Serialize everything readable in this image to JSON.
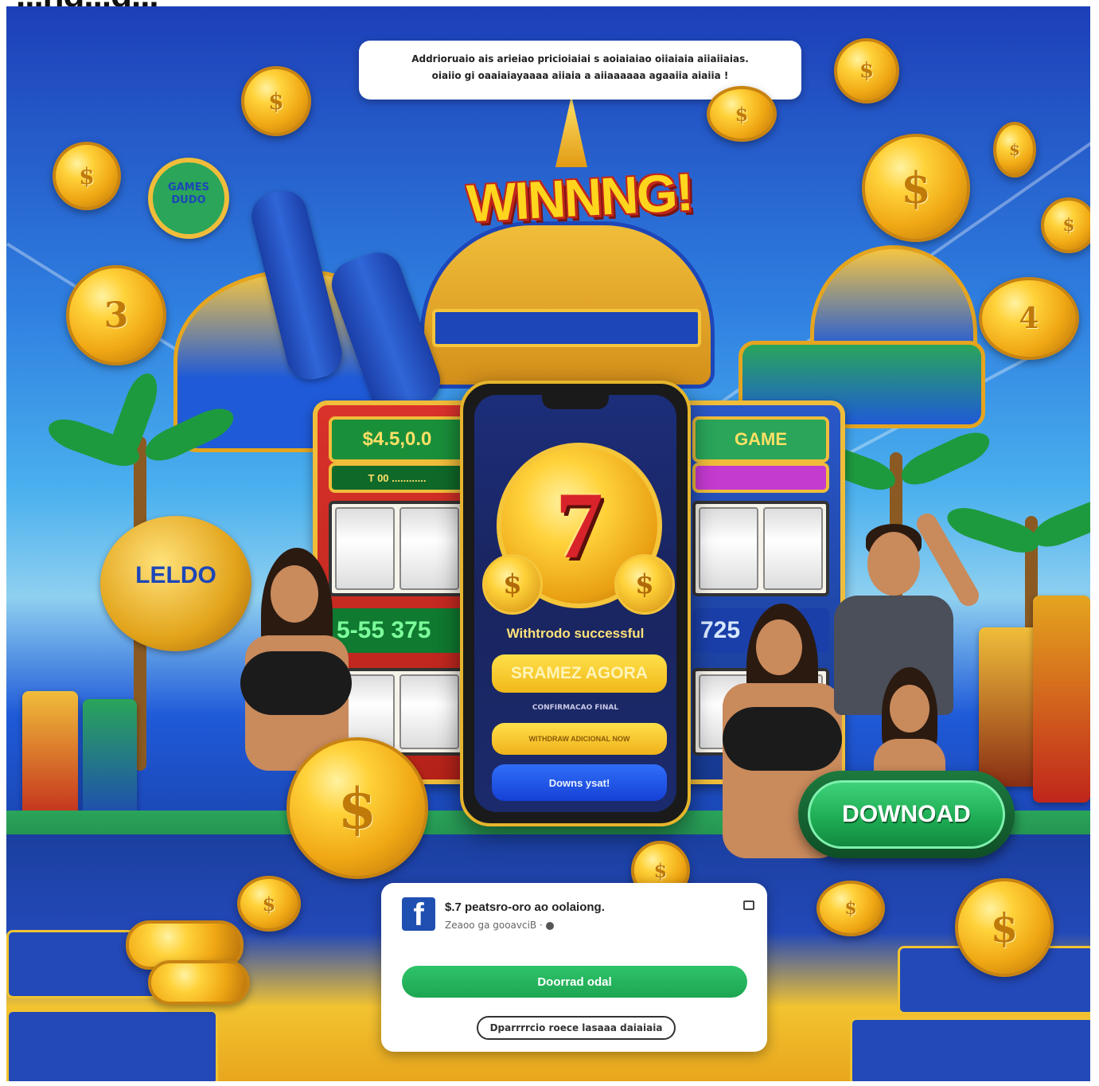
{
  "page": {
    "cropped_headline": "...ng...g..."
  },
  "tooltip": {
    "line1": "Addrioruaio ais arieiao pricioiaiai s aoiaiaiao oiiaiaia aiiaiiaias.",
    "line2": "oiaiio gi oaaiaiayaaaa aiiaia a aiiaaaaaa agaaiia aiaiia !"
  },
  "hero": {
    "title": "WINNNG!"
  },
  "slots": {
    "left_screen": "$4.5,0.0",
    "left_sub": "T 00 ............",
    "left_value": "5-55 375",
    "right_screen": "GAME",
    "right_value": "725"
  },
  "signs": {
    "badge": "GAMES DUDO",
    "lantern": "LELDO"
  },
  "phone": {
    "seven": "7",
    "side_coin_left": "$",
    "side_coin_right": "$",
    "status": "Withtrodo successful",
    "primary_button": "SRAMEZ AGORA",
    "small_caption": "CONFIRMACAO FINAL",
    "secondary_button": "WITHDRAW ADICIONAL NOW",
    "blue_button": "Downs ysat!"
  },
  "download_pill": {
    "label": "DOWNOAD"
  },
  "fb_card": {
    "logo": "f",
    "title": "$.7 peatsro-oro ao oolaiong.",
    "subtitle": "Zeaoo ga gooavciB",
    "subtitle_dot": "·",
    "primary_button": "Doorrad odal",
    "outline_button": "Dparrrrcio roece lasaaa daiaiaia"
  },
  "coins": {
    "symbol_dollar": "$",
    "symbol_three": "3",
    "symbol_four": "4"
  },
  "colors": {
    "gold": "#ffd23a",
    "royal_blue": "#1d46b8",
    "green_cta": "#1fae55",
    "blue_cta": "#1640d6",
    "title_red": "#c0261b"
  }
}
